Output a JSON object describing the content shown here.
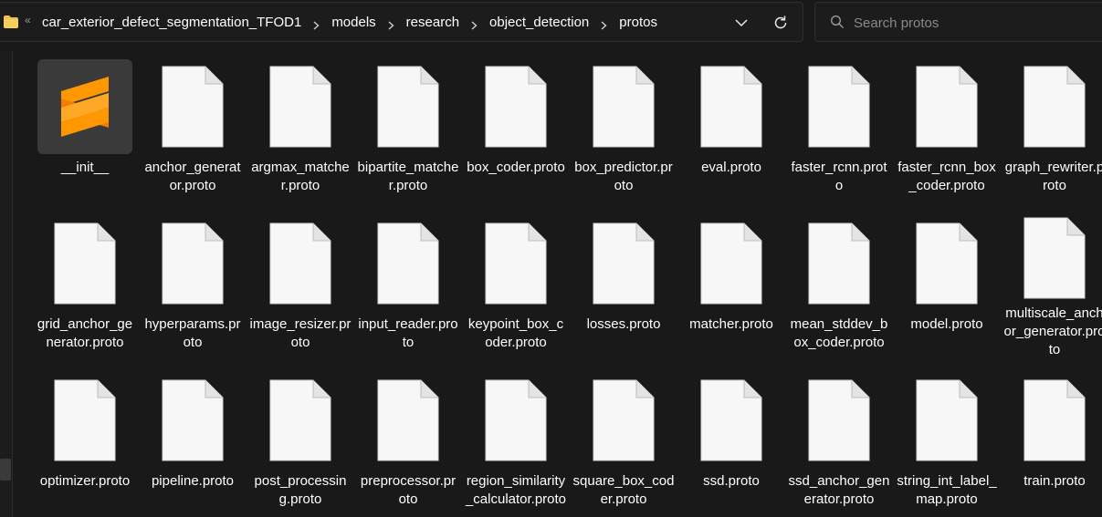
{
  "address_bar": {
    "overflow_label": "«",
    "breadcrumbs": [
      "car_exterior_defect_segmentation_TFOD1",
      "models",
      "research",
      "object_detection",
      "protos"
    ]
  },
  "search": {
    "placeholder": "Search protos",
    "value": ""
  },
  "colors": {
    "background": "#191919",
    "folder": "#f2c14b",
    "sublime_orange": "#ff9800",
    "file_page": "#f7f7f7"
  },
  "files": [
    {
      "name": "__init__",
      "icon": "sublime-text-icon"
    },
    {
      "name": "anchor_generator.proto",
      "icon": "blank-file-icon"
    },
    {
      "name": "argmax_matcher.proto",
      "icon": "blank-file-icon"
    },
    {
      "name": "bipartite_matcher.proto",
      "icon": "blank-file-icon"
    },
    {
      "name": "box_coder.proto",
      "icon": "blank-file-icon"
    },
    {
      "name": "box_predictor.proto",
      "icon": "blank-file-icon"
    },
    {
      "name": "eval.proto",
      "icon": "blank-file-icon"
    },
    {
      "name": "faster_rcnn.proto",
      "icon": "blank-file-icon"
    },
    {
      "name": "faster_rcnn_box_coder.proto",
      "icon": "blank-file-icon"
    },
    {
      "name": "graph_rewriter.proto",
      "icon": "blank-file-icon"
    },
    {
      "name": "grid_anchor_generator.proto",
      "icon": "blank-file-icon"
    },
    {
      "name": "hyperparams.proto",
      "icon": "blank-file-icon"
    },
    {
      "name": "image_resizer.proto",
      "icon": "blank-file-icon"
    },
    {
      "name": "input_reader.proto",
      "icon": "blank-file-icon"
    },
    {
      "name": "keypoint_box_coder.proto",
      "icon": "blank-file-icon"
    },
    {
      "name": "losses.proto",
      "icon": "blank-file-icon"
    },
    {
      "name": "matcher.proto",
      "icon": "blank-file-icon"
    },
    {
      "name": "mean_stddev_box_coder.proto",
      "icon": "blank-file-icon"
    },
    {
      "name": "model.proto",
      "icon": "blank-file-icon"
    },
    {
      "name": "multiscale_anchor_generator.proto",
      "icon": "blank-file-icon"
    },
    {
      "name": "optimizer.proto",
      "icon": "blank-file-icon"
    },
    {
      "name": "pipeline.proto",
      "icon": "blank-file-icon"
    },
    {
      "name": "post_processing.proto",
      "icon": "blank-file-icon"
    },
    {
      "name": "preprocessor.proto",
      "icon": "blank-file-icon"
    },
    {
      "name": "region_similarity_calculator.proto",
      "icon": "blank-file-icon"
    },
    {
      "name": "square_box_coder.proto",
      "icon": "blank-file-icon"
    },
    {
      "name": "ssd.proto",
      "icon": "blank-file-icon"
    },
    {
      "name": "ssd_anchor_generator.proto",
      "icon": "blank-file-icon"
    },
    {
      "name": "string_int_label_map.proto",
      "icon": "blank-file-icon"
    },
    {
      "name": "train.proto",
      "icon": "blank-file-icon"
    }
  ]
}
